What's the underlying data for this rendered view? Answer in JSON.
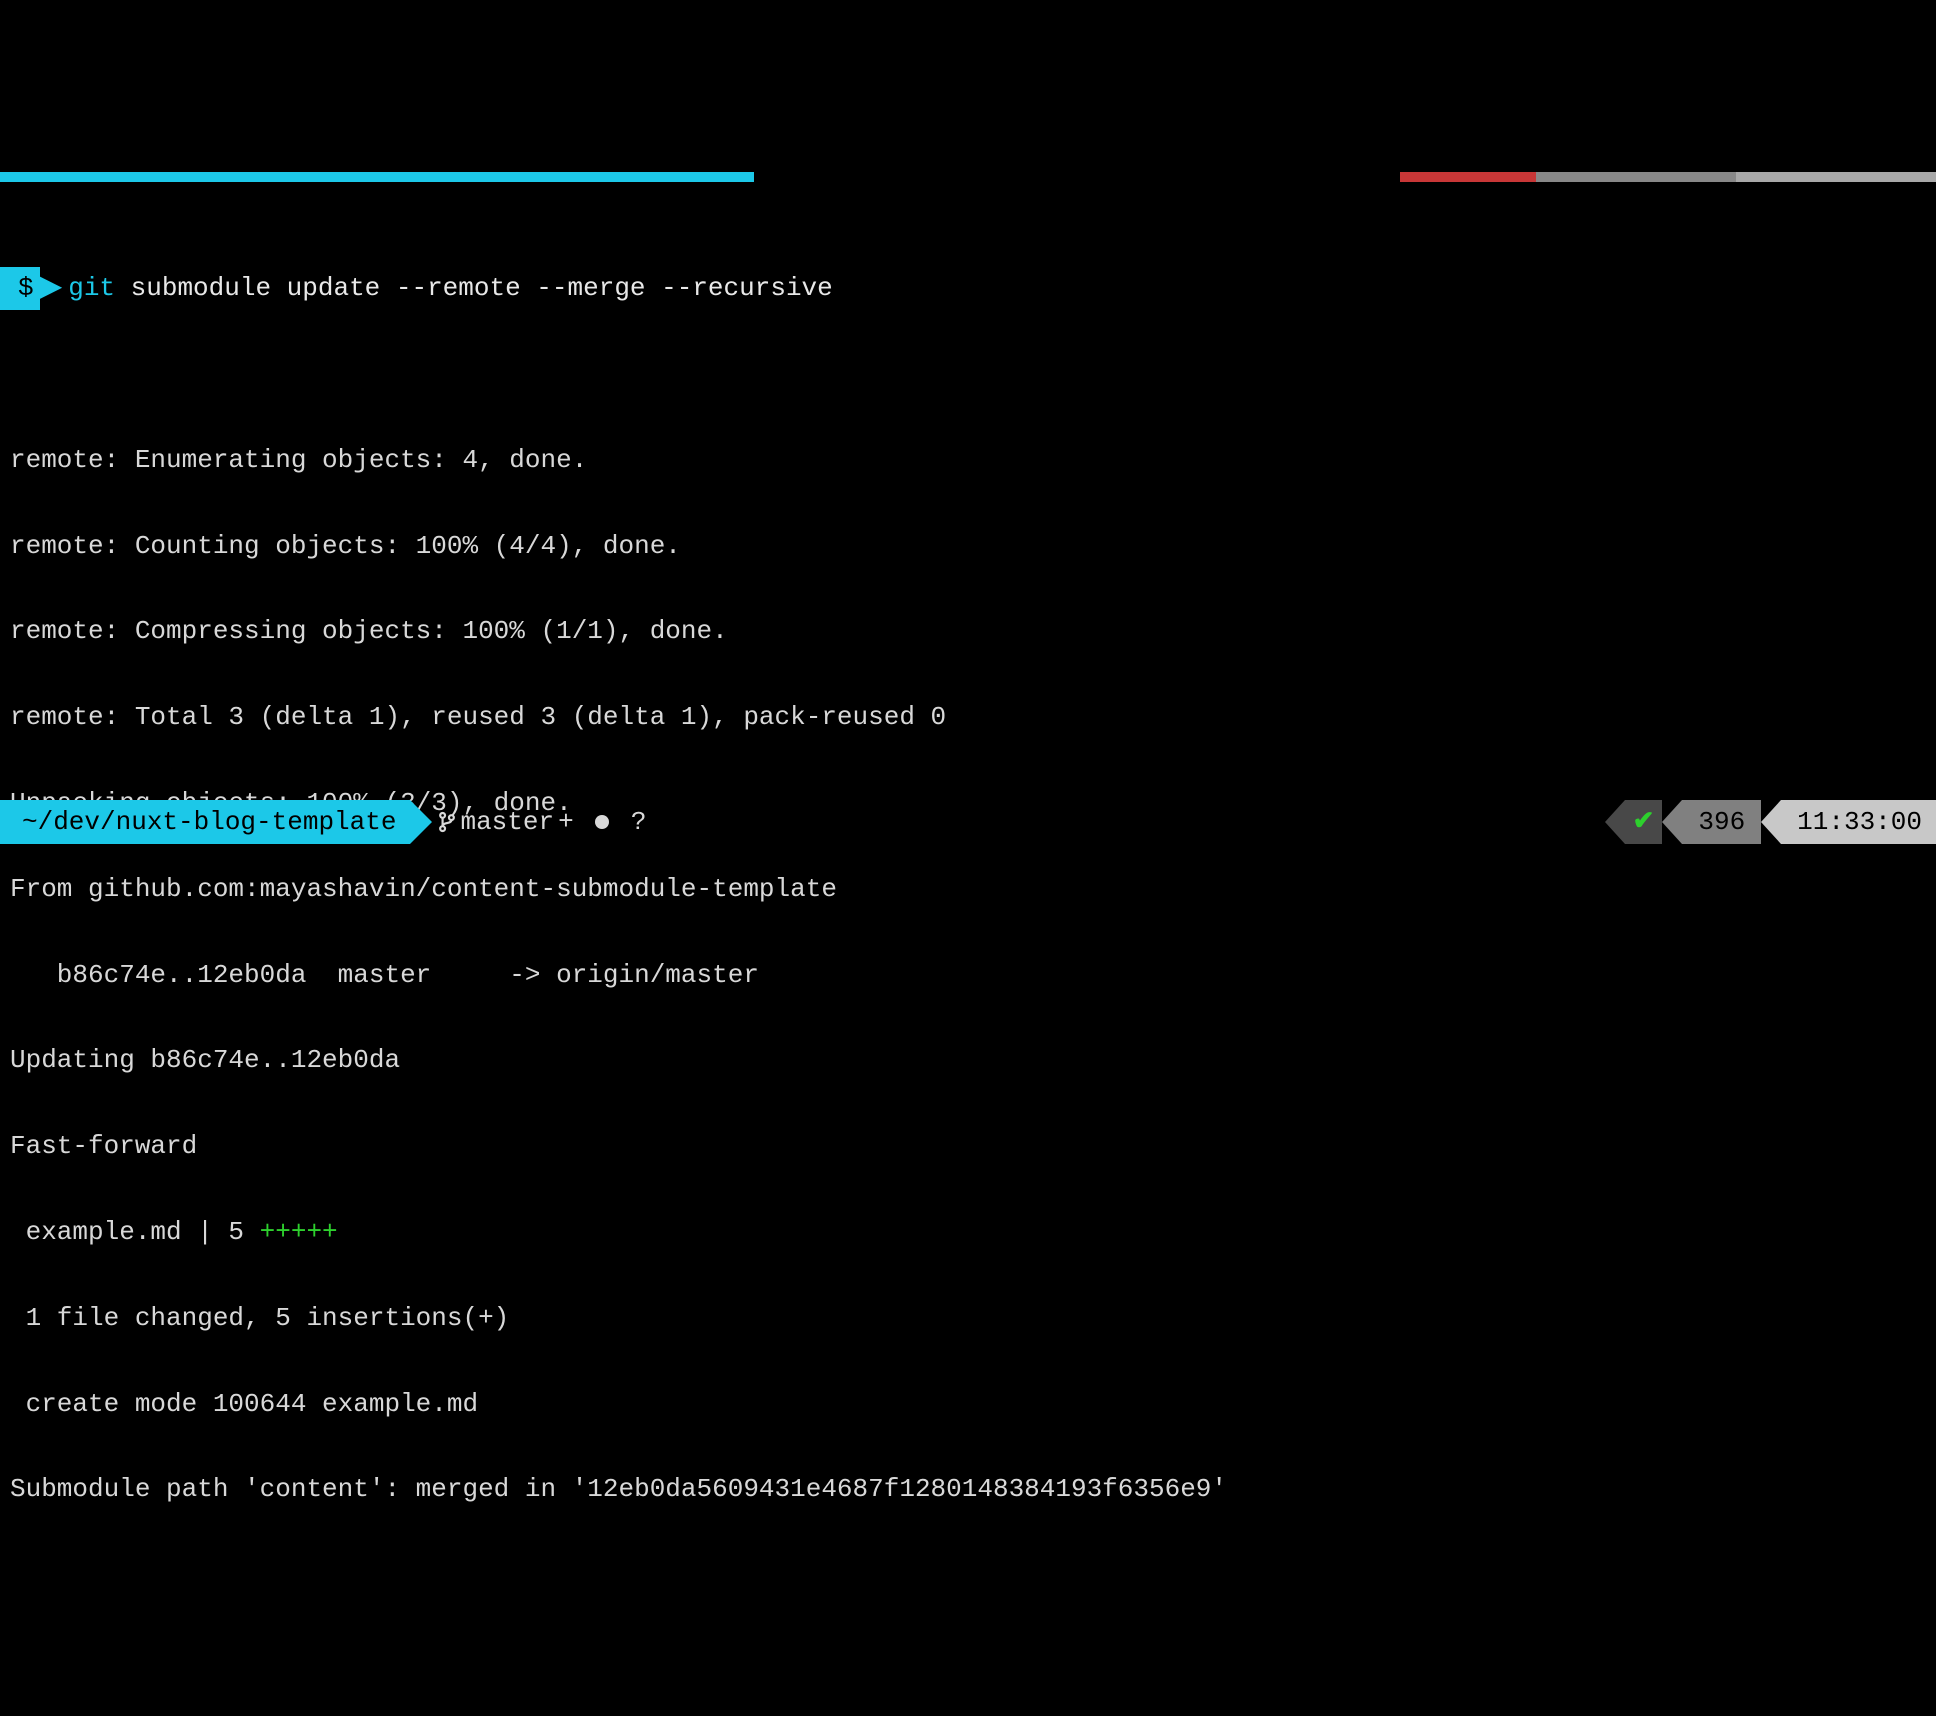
{
  "prompt": {
    "symbol": "$",
    "git_keyword": "git",
    "command_rest": " submodule update --remote --merge --recursive"
  },
  "output": {
    "l1": "remote: Enumerating objects: 4, done.",
    "l2": "remote: Counting objects: 100% (4/4), done.",
    "l3": "remote: Compressing objects: 100% (1/1), done.",
    "l4": "remote: Total 3 (delta 1), reused 3 (delta 1), pack-reused 0",
    "l5": "Unpacking objects: 100% (3/3), done.",
    "l6": "From github.com:mayashavin/content-submodule-template",
    "l7": "   b86c74e..12eb0da  master     -> origin/master",
    "l8": "Updating b86c74e..12eb0da",
    "l9": "Fast-forward",
    "l10a": " example.md | 5 ",
    "l10b": "+++++",
    "l11": " 1 file changed, 5 insertions(+)",
    "l12": " create mode 100644 example.md",
    "l13": "Submodule path 'content': merged in '12eb0da5609431e4687f1280148384193f6356e9'"
  },
  "status": {
    "path": "~/dev/nuxt-blog-template",
    "branch": "master",
    "indicators": "+ ",
    "question": " ?",
    "check": "✔",
    "number": "396",
    "time": "11:33:00"
  }
}
